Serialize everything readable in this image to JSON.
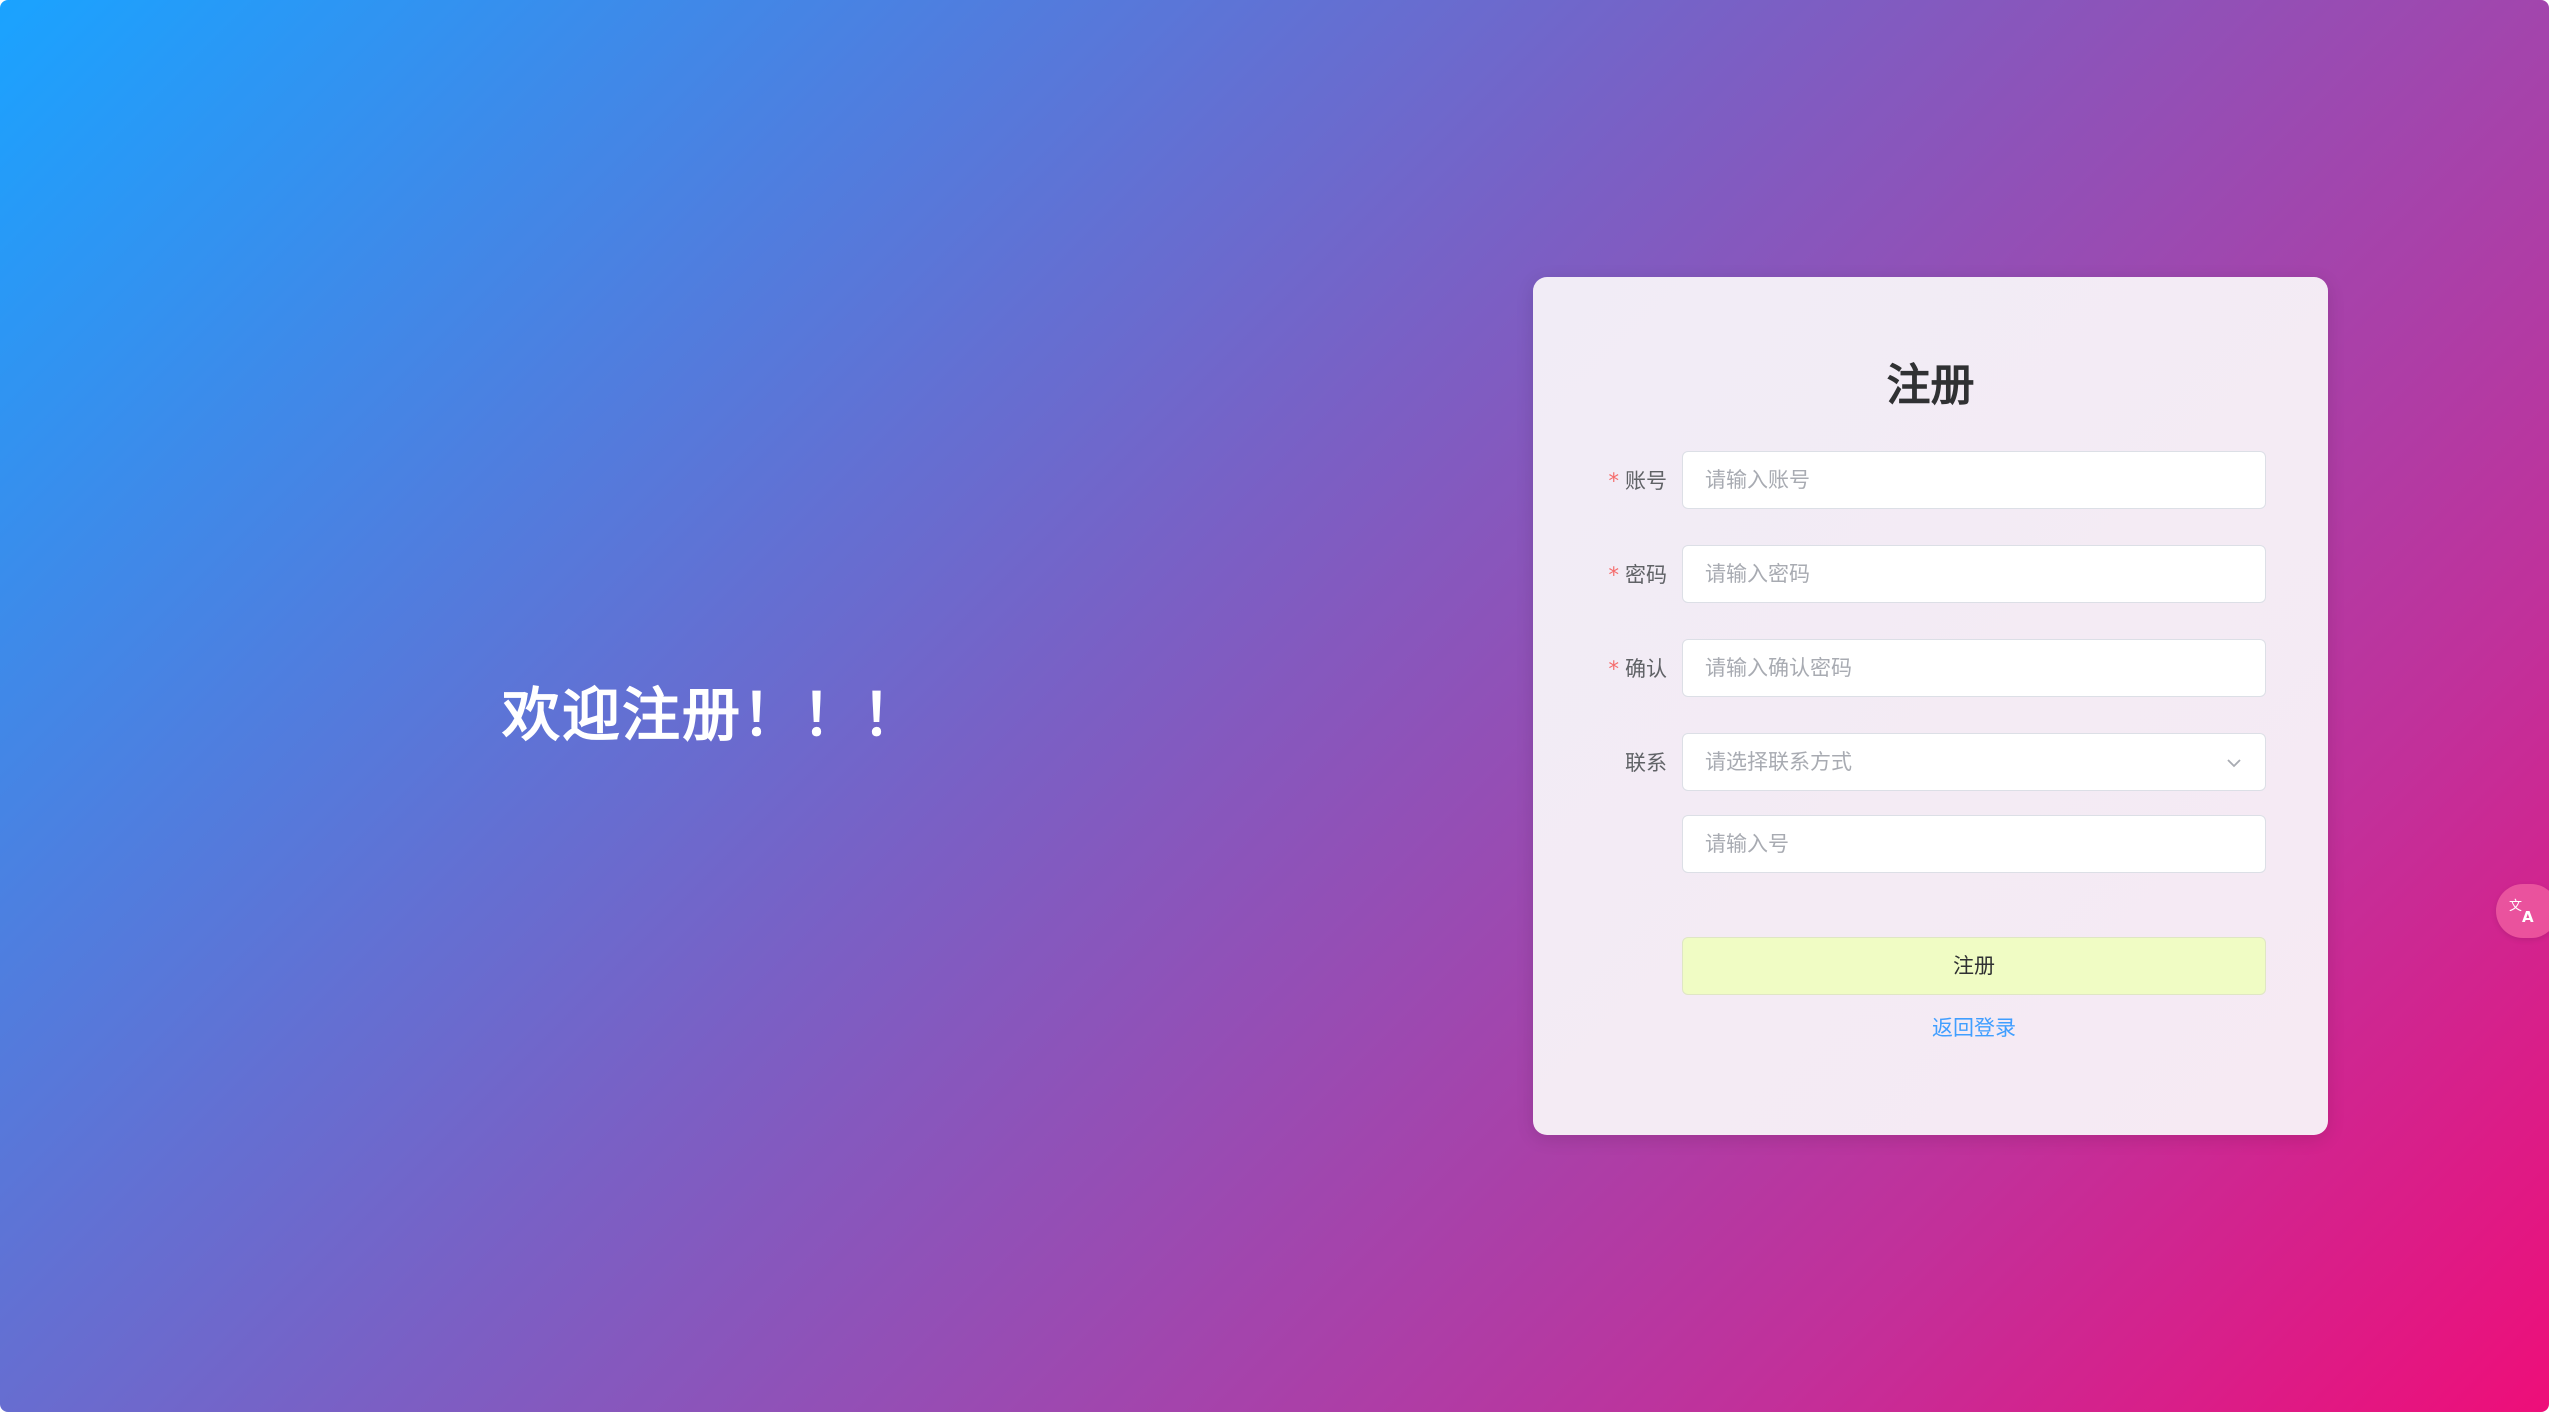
{
  "welcome": {
    "text": "欢迎注册！！！"
  },
  "register_card": {
    "title": "注册",
    "fields": {
      "account": {
        "required_mark": "*",
        "label": "账号",
        "placeholder": "请输入账号",
        "value": ""
      },
      "password": {
        "required_mark": "*",
        "label": "密码",
        "placeholder": "请输入密码",
        "value": ""
      },
      "confirm": {
        "required_mark": "*",
        "label": "确认",
        "placeholder": "请输入确认密码",
        "value": ""
      },
      "contact": {
        "label": "联系",
        "select_placeholder": "请选择联系方式",
        "number_placeholder": "请输入号",
        "number_value": ""
      }
    },
    "submit_label": "注册",
    "back_link_label": "返回登录"
  },
  "translate_button": {
    "icon": "translate-icon"
  },
  "colors": {
    "gradient_start": "#1aa3ff",
    "gradient_end": "#ee0e79",
    "submit_bg": "#f0fcc4",
    "link": "#409eff",
    "required": "#f56c6c"
  }
}
